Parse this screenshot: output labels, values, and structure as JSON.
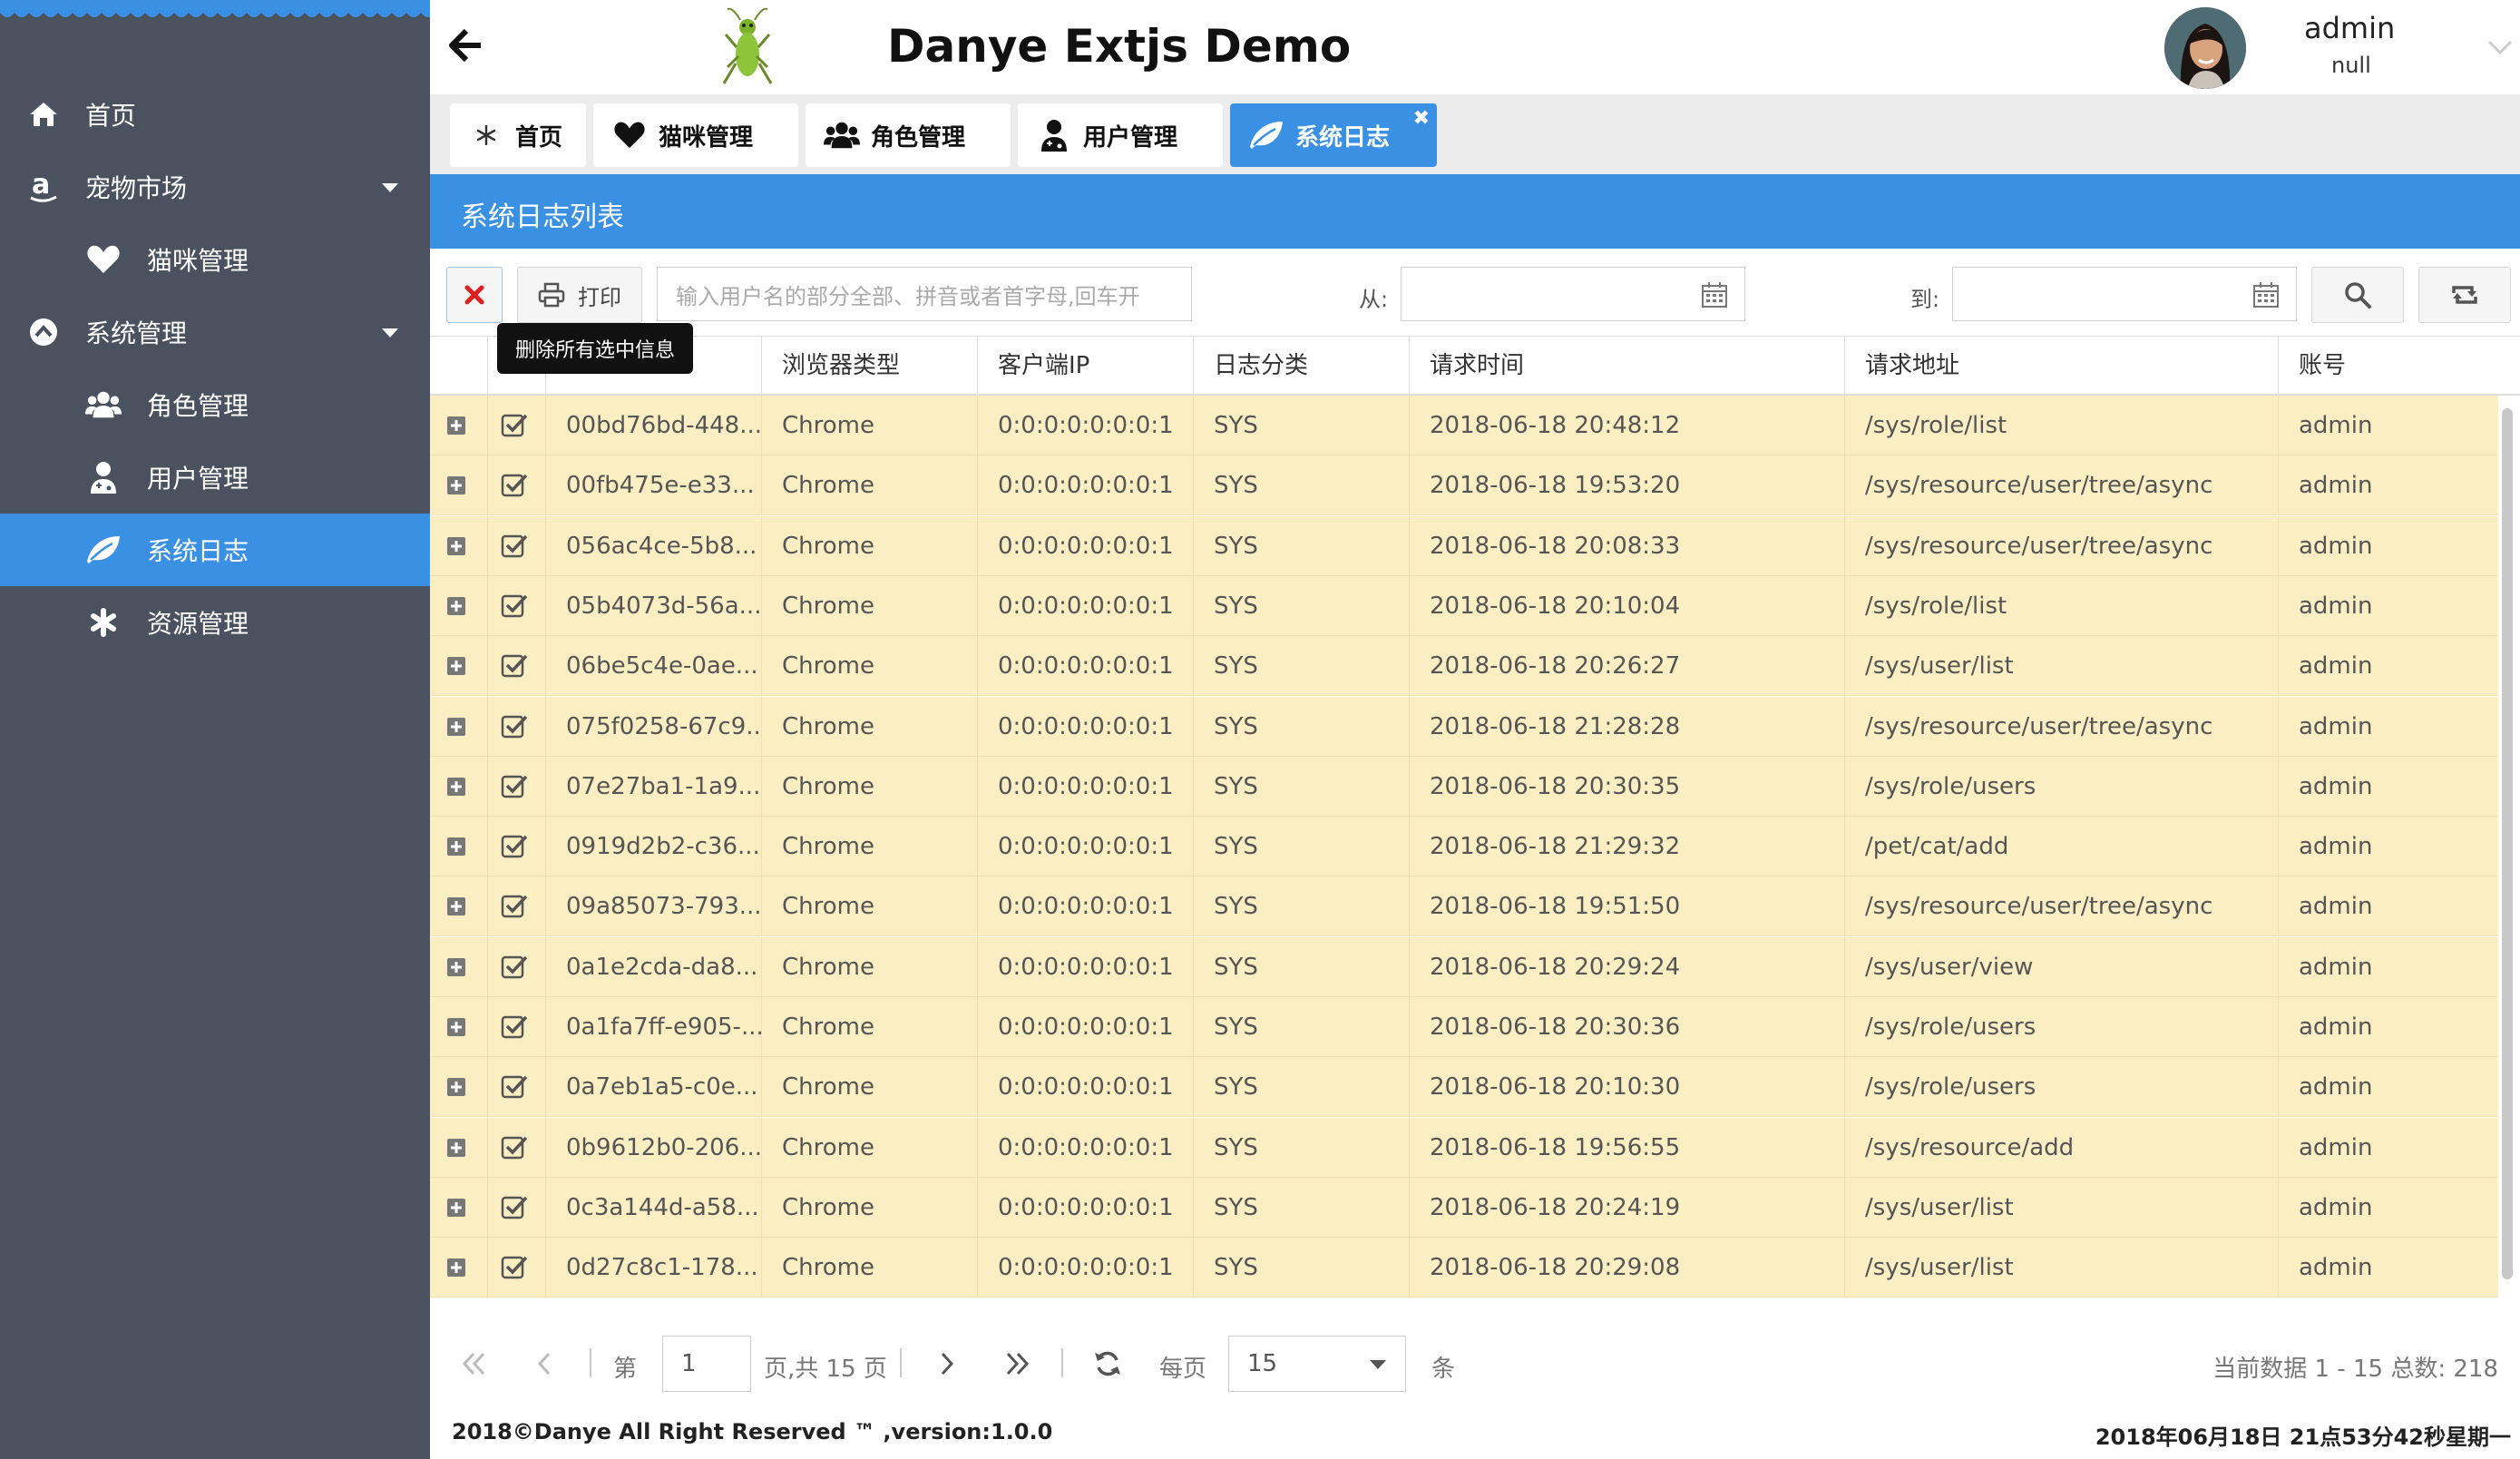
{
  "app": {
    "title": "Danye Extjs Demo",
    "user": {
      "name": "admin",
      "sub": "null"
    }
  },
  "sidebar": {
    "items": [
      {
        "label": "首页",
        "icon": "home-icon"
      },
      {
        "label": "宠物市场",
        "icon": "amazon-icon",
        "expandable": true
      },
      {
        "label": "猫咪管理",
        "icon": "heart-icon"
      },
      {
        "label": "系统管理",
        "icon": "chevron-circle-up-icon",
        "expandable": true
      },
      {
        "label": "角色管理",
        "icon": "users-icon"
      },
      {
        "label": "用户管理",
        "icon": "user-doctor-icon"
      },
      {
        "label": "系统日志",
        "icon": "leaf-icon",
        "active": true
      },
      {
        "label": "资源管理",
        "icon": "asterisk-icon"
      }
    ]
  },
  "tabs": [
    {
      "label": "首页",
      "icon": "asterisk-icon"
    },
    {
      "label": "猫咪管理",
      "icon": "heart-icon"
    },
    {
      "label": "角色管理",
      "icon": "users-icon"
    },
    {
      "label": "用户管理",
      "icon": "user-doctor-icon"
    },
    {
      "label": "系统日志",
      "icon": "leaf-icon",
      "active": true,
      "close": "✖"
    }
  ],
  "panel": {
    "title": "系统日志列表"
  },
  "toolbar": {
    "print_label": "打印",
    "search_placeholder": "输入用户名的部分全部、拼音或者首字母,回车开",
    "from_label": "从:",
    "to_label": "到:",
    "tooltip": "删除所有选中信息"
  },
  "grid": {
    "columns": [
      "浏览器类型",
      "客户端IP",
      "日志分类",
      "请求时间",
      "请求地址",
      "账号"
    ],
    "rows": [
      {
        "id": "00bd76bd-448...",
        "browser": "Chrome",
        "ip": "0:0:0:0:0:0:0:1",
        "type": "SYS",
        "time": "2018-06-18 20:48:12",
        "url": "/sys/role/list",
        "account": "admin"
      },
      {
        "id": "00fb475e-e33...",
        "browser": "Chrome",
        "ip": "0:0:0:0:0:0:0:1",
        "type": "SYS",
        "time": "2018-06-18 19:53:20",
        "url": "/sys/resource/user/tree/async",
        "account": "admin"
      },
      {
        "id": "056ac4ce-5b8...",
        "browser": "Chrome",
        "ip": "0:0:0:0:0:0:0:1",
        "type": "SYS",
        "time": "2018-06-18 20:08:33",
        "url": "/sys/resource/user/tree/async",
        "account": "admin"
      },
      {
        "id": "05b4073d-56a...",
        "browser": "Chrome",
        "ip": "0:0:0:0:0:0:0:1",
        "type": "SYS",
        "time": "2018-06-18 20:10:04",
        "url": "/sys/role/list",
        "account": "admin"
      },
      {
        "id": "06be5c4e-0ae...",
        "browser": "Chrome",
        "ip": "0:0:0:0:0:0:0:1",
        "type": "SYS",
        "time": "2018-06-18 20:26:27",
        "url": "/sys/user/list",
        "account": "admin"
      },
      {
        "id": "075f0258-67c9...",
        "browser": "Chrome",
        "ip": "0:0:0:0:0:0:0:1",
        "type": "SYS",
        "time": "2018-06-18 21:28:28",
        "url": "/sys/resource/user/tree/async",
        "account": "admin"
      },
      {
        "id": "07e27ba1-1a9...",
        "browser": "Chrome",
        "ip": "0:0:0:0:0:0:0:1",
        "type": "SYS",
        "time": "2018-06-18 20:30:35",
        "url": "/sys/role/users",
        "account": "admin"
      },
      {
        "id": "0919d2b2-c36...",
        "browser": "Chrome",
        "ip": "0:0:0:0:0:0:0:1",
        "type": "SYS",
        "time": "2018-06-18 21:29:32",
        "url": "/pet/cat/add",
        "account": "admin"
      },
      {
        "id": "09a85073-793...",
        "browser": "Chrome",
        "ip": "0:0:0:0:0:0:0:1",
        "type": "SYS",
        "time": "2018-06-18 19:51:50",
        "url": "/sys/resource/user/tree/async",
        "account": "admin"
      },
      {
        "id": "0a1e2cda-da8...",
        "browser": "Chrome",
        "ip": "0:0:0:0:0:0:0:1",
        "type": "SYS",
        "time": "2018-06-18 20:29:24",
        "url": "/sys/user/view",
        "account": "admin"
      },
      {
        "id": "0a1fa7ff-e905-...",
        "browser": "Chrome",
        "ip": "0:0:0:0:0:0:0:1",
        "type": "SYS",
        "time": "2018-06-18 20:30:36",
        "url": "/sys/role/users",
        "account": "admin"
      },
      {
        "id": "0a7eb1a5-c0e...",
        "browser": "Chrome",
        "ip": "0:0:0:0:0:0:0:1",
        "type": "SYS",
        "time": "2018-06-18 20:10:30",
        "url": "/sys/role/users",
        "account": "admin"
      },
      {
        "id": "0b9612b0-206...",
        "browser": "Chrome",
        "ip": "0:0:0:0:0:0:0:1",
        "type": "SYS",
        "time": "2018-06-18 19:56:55",
        "url": "/sys/resource/add",
        "account": "admin"
      },
      {
        "id": "0c3a144d-a58...",
        "browser": "Chrome",
        "ip": "0:0:0:0:0:0:0:1",
        "type": "SYS",
        "time": "2018-06-18 20:24:19",
        "url": "/sys/user/list",
        "account": "admin"
      },
      {
        "id": "0d27c8c1-178...",
        "browser": "Chrome",
        "ip": "0:0:0:0:0:0:0:1",
        "type": "SYS",
        "time": "2018-06-18 20:29:08",
        "url": "/sys/user/list",
        "account": "admin"
      }
    ]
  },
  "pager": {
    "page_prefix": "第",
    "page_value": "1",
    "page_suffix": "页,共 15 页",
    "per_page_label": "每页",
    "per_page_value": "15",
    "unit": "条",
    "summary": "当前数据 1 - 15 总数:   218"
  },
  "footer": {
    "copyright": "2018©Danye All Right Reserved ™ ,version:1.0.0",
    "datetime": "2018年06月18日 21点53分42秒星期一"
  },
  "colors": {
    "accent": "#3a91e4",
    "sidebar": "#4a525f",
    "row_highlight": "#fbeec3"
  }
}
